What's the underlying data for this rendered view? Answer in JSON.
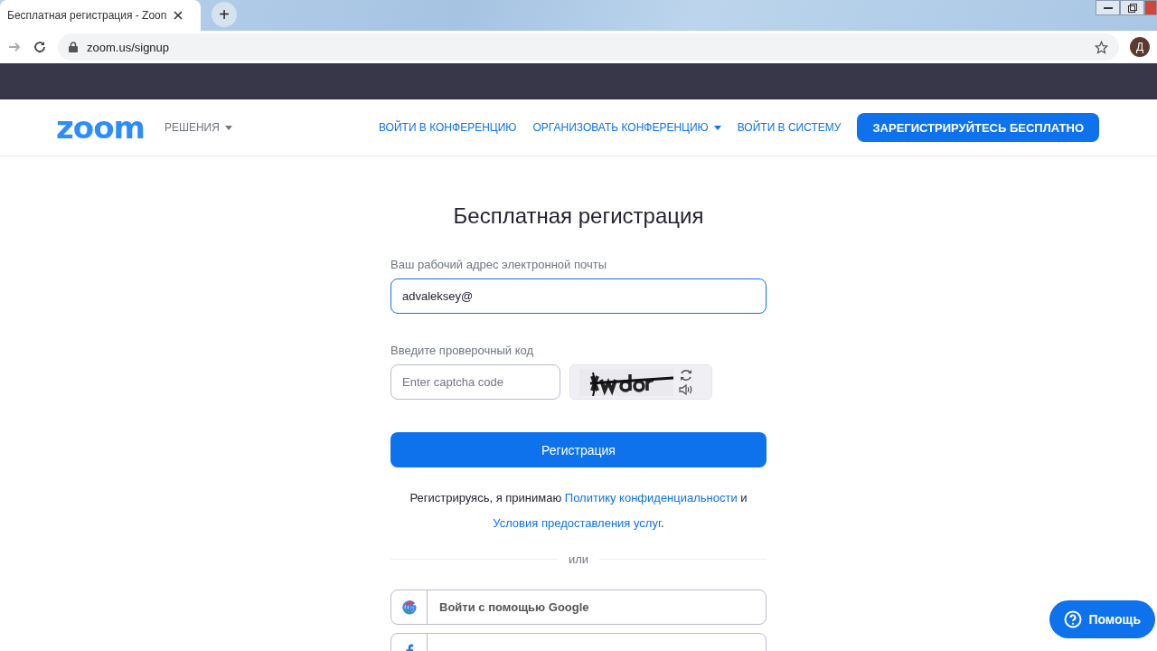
{
  "browser": {
    "tab_title": "Бесплатная регистрация - Zoon",
    "new_tab": "+",
    "url": "zoom.us/signup",
    "profile_initial": "Д"
  },
  "header": {
    "logo": "zoom",
    "solutions": "РЕШЕНИЯ",
    "nav": [
      {
        "label": "ВОЙТИ В КОНФЕРЕНЦИЮ",
        "dropdown": false
      },
      {
        "label": "ОРГАНИЗОВАТЬ КОНФЕРЕНЦИЮ",
        "dropdown": true
      },
      {
        "label": "ВОЙТИ В СИСТЕМУ",
        "dropdown": false
      }
    ],
    "signup_button": "ЗАРЕГИСТРИРУЙТЕСЬ БЕСПЛАТНО"
  },
  "form": {
    "title": "Бесплатная регистрация",
    "email_label": "Ваш рабочий адрес электронной почты",
    "email_value": "advaleksey@",
    "captcha_label": "Введите проверочный код",
    "captcha_placeholder": "Enter captcha code",
    "submit": "Регистрация",
    "terms_prefix": "Регистрируясь, я принимаю",
    "privacy_link": "Политику конфиденциальности",
    "terms_and": "и",
    "terms_link": "Условия предоставления услуг",
    "terms_end": ".",
    "divider": "или",
    "social": [
      {
        "kind": "google",
        "label": "Войти с помощью Google"
      },
      {
        "kind": "facebook"
      }
    ]
  },
  "help_button": "Помощь"
}
